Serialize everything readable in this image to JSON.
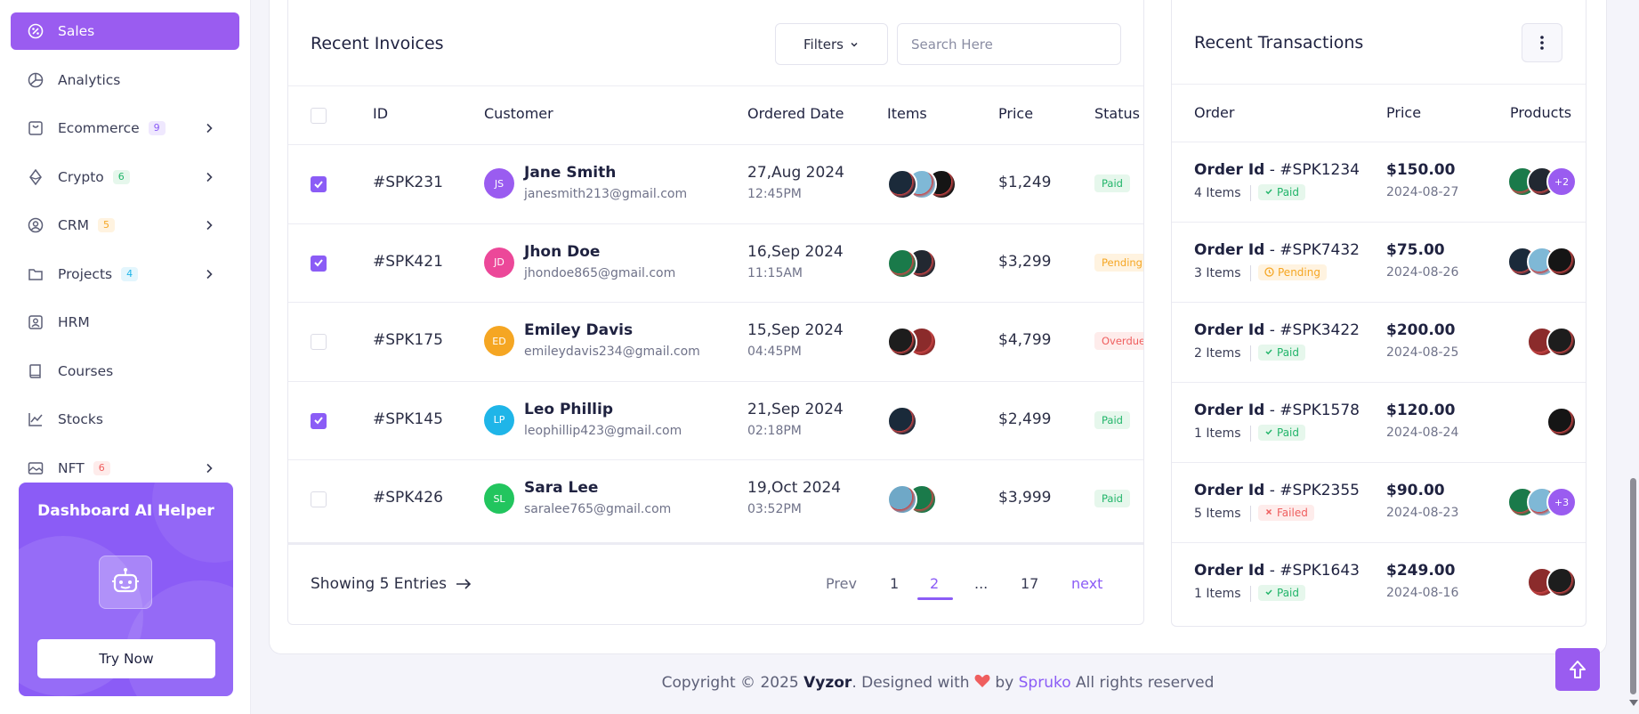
{
  "sidebar": {
    "items": [
      {
        "label": "Sales",
        "icon": "sales-icon",
        "active": true
      },
      {
        "label": "Analytics",
        "icon": "analytics-icon"
      },
      {
        "label": "Ecommerce",
        "icon": "ecommerce-icon",
        "badge": "9",
        "badge_color": "#8b5cf6",
        "badge_bg": "#efe8fe",
        "expandable": true
      },
      {
        "label": "Crypto",
        "icon": "crypto-icon",
        "badge": "6",
        "badge_color": "#22b56a",
        "badge_bg": "#e6f7ec",
        "expandable": true
      },
      {
        "label": "CRM",
        "icon": "crm-icon",
        "badge": "5",
        "badge_color": "#f5a623",
        "badge_bg": "#fff3e0",
        "expandable": true
      },
      {
        "label": "Projects",
        "icon": "projects-icon",
        "badge": "4",
        "badge_color": "#1fb5e8",
        "badge_bg": "#e3f6fd",
        "expandable": true
      },
      {
        "label": "HRM",
        "icon": "hrm-icon"
      },
      {
        "label": "Courses",
        "icon": "courses-icon"
      },
      {
        "label": "Stocks",
        "icon": "stocks-icon"
      },
      {
        "label": "NFT",
        "icon": "nft-icon",
        "badge": "6",
        "badge_color": "#ef5e5e",
        "badge_bg": "#feeceb",
        "expandable": true
      }
    ],
    "helper": {
      "title": "Dashboard AI Helper",
      "button": "Try Now"
    }
  },
  "invoices": {
    "title": "Recent Invoices",
    "filters_label": "Filters",
    "search_placeholder": "Search Here",
    "columns": {
      "id": "ID",
      "customer": "Customer",
      "date": "Ordered Date",
      "items": "Items",
      "price": "Price",
      "status": "Status"
    },
    "rows": [
      {
        "checked": true,
        "id": "#SPK231",
        "initials": "JS",
        "avatar_color": "#9a5cf0",
        "name": "Jane Smith",
        "email": "janesmith213@gmail.com",
        "date": "27,Aug 2024",
        "time": "12:45PM",
        "products": [
          "#1b2a3a",
          "#7fb8d6",
          "#151515"
        ],
        "price": "$1,249",
        "status": "Paid",
        "status_type": "paid"
      },
      {
        "checked": true,
        "id": "#SPK421",
        "initials": "JD",
        "avatar_color": "#ec4899",
        "name": "Jhon Doe",
        "email": "jhondoe865@gmail.com",
        "date": "16,Sep 2024",
        "time": "11:15AM",
        "products": [
          "#1a7a4a",
          "#222831"
        ],
        "price": "$3,299",
        "status": "Pending",
        "status_type": "pending"
      },
      {
        "checked": false,
        "id": "#SPK175",
        "initials": "ED",
        "avatar_color": "#f5a623",
        "name": "Emiley Davis",
        "email": "emileydavis234@gmail.com",
        "date": "15,Sep 2024",
        "time": "04:45PM",
        "products": [
          "#1d1d1d",
          "#8b2b2b"
        ],
        "price": "$4,799",
        "status": "Overdue",
        "status_type": "overdue"
      },
      {
        "checked": true,
        "id": "#SPK145",
        "initials": "LP",
        "avatar_color": "#1fb5e8",
        "name": "Leo Phillip",
        "email": "leophillip423@gmail.com",
        "date": "21,Sep 2024",
        "time": "02:18PM",
        "products": [
          "#1a2a3a"
        ],
        "price": "$2,499",
        "status": "Paid",
        "status_type": "paid"
      },
      {
        "checked": false,
        "id": "#SPK426",
        "initials": "SL",
        "avatar_color": "#22c55e",
        "name": "Sara Lee",
        "email": "saralee765@gmail.com",
        "date": "19,Oct 2024",
        "time": "03:52PM",
        "products": [
          "#6fa8c7",
          "#1a7a4a"
        ],
        "price": "$3,999",
        "status": "Paid",
        "status_type": "paid"
      }
    ],
    "footer": {
      "showing": "Showing 5 Entries",
      "prev": "Prev",
      "pages": [
        "1",
        "2",
        "...",
        "17"
      ],
      "current_page": "2",
      "next": "next"
    }
  },
  "transactions": {
    "title": "Recent Transactions",
    "columns": {
      "order": "Order",
      "price": "Price",
      "products": "Products"
    },
    "rows": [
      {
        "order_prefix": "Order Id",
        "order_id": " - #SPK1234",
        "items": "4 Items",
        "status": "Paid",
        "status_type": "paid",
        "price": "$150.00",
        "date": "2024-08-27",
        "products": [
          "#1a7a4a",
          "#222831"
        ],
        "more": "+2"
      },
      {
        "order_prefix": "Order Id",
        "order_id": " - #SPK7432",
        "items": "3 Items",
        "status": "Pending",
        "status_type": "pending",
        "price": "$75.00",
        "date": "2024-08-26",
        "products": [
          "#1b2a3a",
          "#7fb8d6",
          "#151515"
        ],
        "more": ""
      },
      {
        "order_prefix": "Order Id",
        "order_id": " - #SPK3422",
        "items": "2 Items",
        "status": "Paid",
        "status_type": "paid",
        "price": "$200.00",
        "date": "2024-08-25",
        "products": [
          "#8b2b2b",
          "#1d1d1d"
        ],
        "more": ""
      },
      {
        "order_prefix": "Order Id",
        "order_id": " - #SPK1578",
        "items": "1 Items",
        "status": "Paid",
        "status_type": "paid",
        "price": "$120.00",
        "date": "2024-08-24",
        "products": [
          "#151515"
        ],
        "more": ""
      },
      {
        "order_prefix": "Order Id",
        "order_id": " - #SPK2355",
        "items": "5 Items",
        "status": "Failed",
        "status_type": "failed",
        "price": "$90.00",
        "date": "2024-08-23",
        "products": [
          "#1a7a4a",
          "#7fb8d6"
        ],
        "more": "+3"
      },
      {
        "order_prefix": "Order Id",
        "order_id": " - #SPK1643",
        "items": "1 Items",
        "status": "Paid",
        "status_type": "paid",
        "price": "$249.00",
        "date": "2024-08-16",
        "products": [
          "#8b2b2b",
          "#1d1d1d"
        ],
        "more": ""
      }
    ]
  },
  "footer": {
    "copyright": "Copyright © 2025 ",
    "brand_name": "Vyzor",
    "designed": ". Designed with ",
    "by": " by ",
    "company": "Spruko",
    "rights": " All rights reserved"
  },
  "colors": {
    "accent": "#8b5cf6",
    "accent_active": "#9a5cf0"
  }
}
